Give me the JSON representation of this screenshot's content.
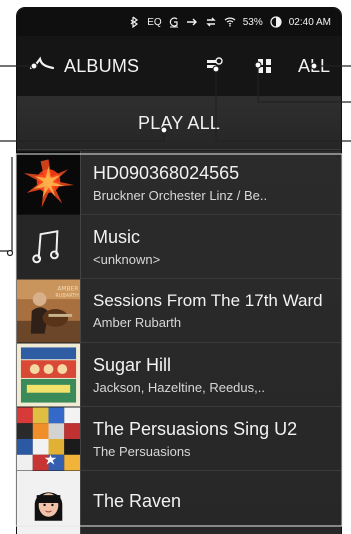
{
  "status_bar": {
    "eq": "EQ",
    "battery": "53%",
    "time": "02:40 AM"
  },
  "toolbar": {
    "title": "ALBUMS",
    "sort_label": "ALL",
    "back_icon": "back-icon",
    "view_toggle_icon": "view-toggle-icon",
    "grid_icon": "grid-icon"
  },
  "play_all": {
    "label": "PLAY ALL"
  },
  "albums": [
    {
      "title": "HD090368024565",
      "subtitle": "Bruckner Orchester Linz / Be..",
      "art": "starburst-cover"
    },
    {
      "title": "Music",
      "subtitle": "<unknown>",
      "art": "music-note-icon"
    },
    {
      "title": "Sessions From The 17th Ward",
      "subtitle": "Amber Rubarth",
      "art": "guitarist-cover"
    },
    {
      "title": "Sugar Hill",
      "subtitle": "Jackson, Hazeltine, Reedus,..",
      "art": "sugar-hill-cover"
    },
    {
      "title": "The Persuasions Sing U2",
      "subtitle": "The Persuasions",
      "art": "mosaic-cover"
    },
    {
      "title": "The Raven",
      "subtitle": "",
      "art": "raven-cover"
    }
  ]
}
